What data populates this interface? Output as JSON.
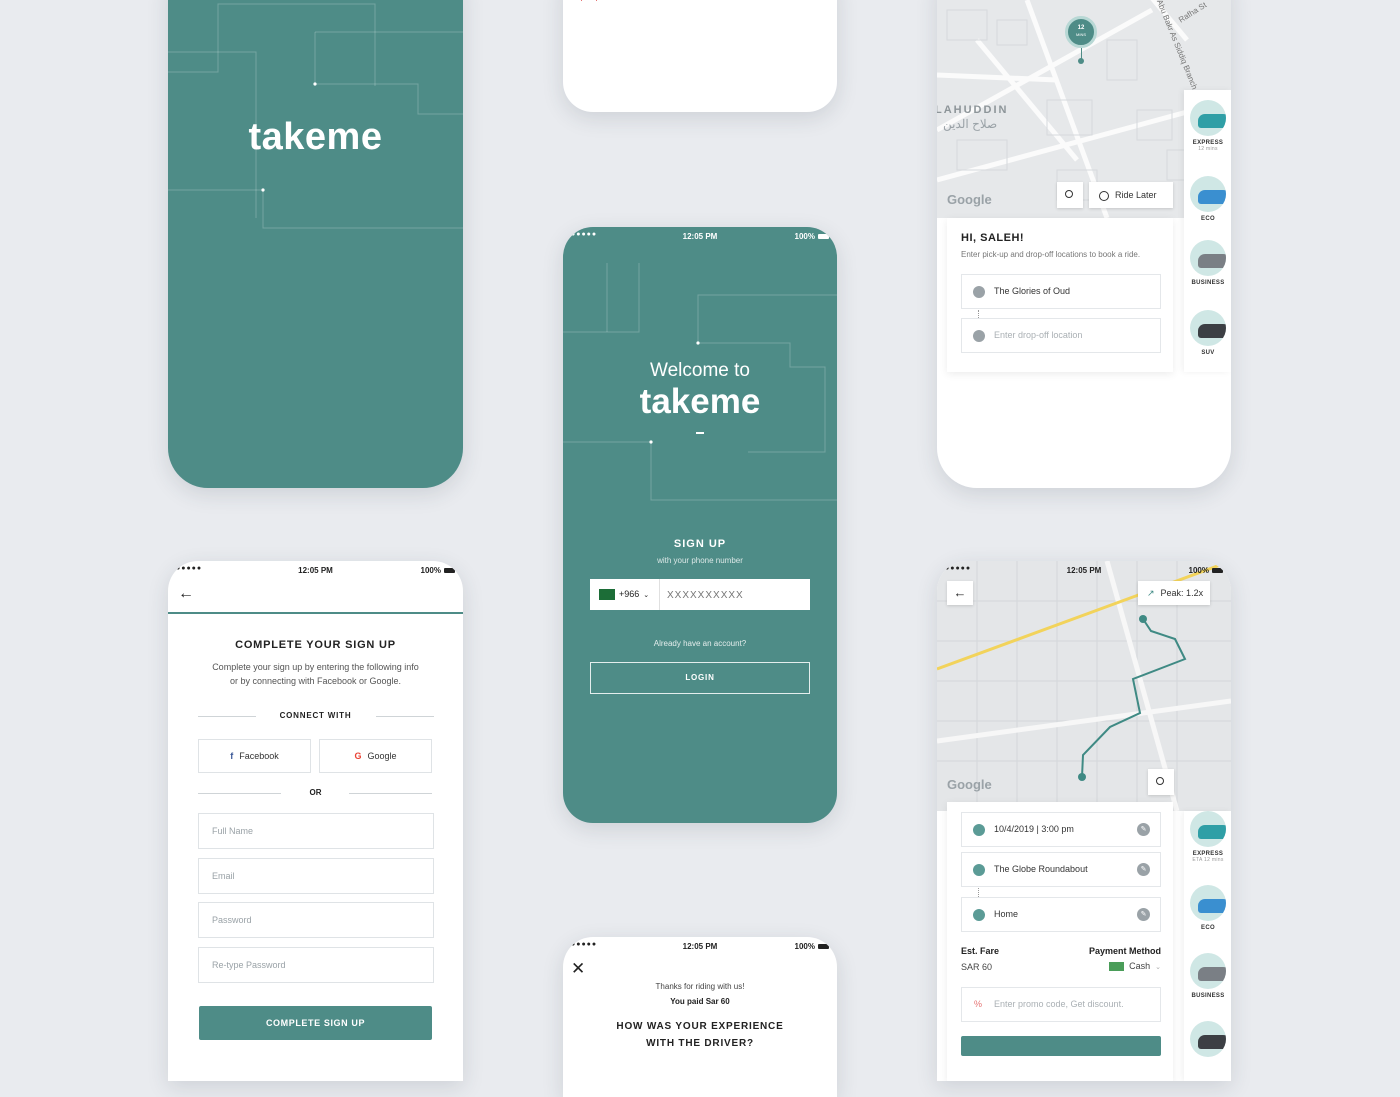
{
  "colors": {
    "teal": "#4e8c87",
    "background": "#e9ebef",
    "route": "#3f8a84",
    "map_road_yellow": "#f2d35b"
  },
  "status_bar": {
    "signal": "●●●●●",
    "time": "12:05 PM",
    "battery": "100%"
  },
  "splash": {
    "brand": "takeme"
  },
  "welcome": {
    "title_line1": "Welcome to",
    "brand": "takeme",
    "signup_title": "SIGN UP",
    "signup_sub": "with your phone number",
    "country_code": "+966",
    "phone_placeholder": "XXXXXXXXXX",
    "already": "Already have an account?",
    "login": "LOGIN"
  },
  "home_map": {
    "eta_number": "12",
    "eta_unit": "MINS",
    "street_1": "Rafha St",
    "street_2": "Abu Bakr As Siddiq Branch",
    "district_en": "LAHUDDIN",
    "district_ar": "صلاح الدين",
    "google": "Google",
    "ride_later": "Ride Later",
    "greeting": "HI, SALEH!",
    "instructions": "Enter pick-up and drop-off locations to book a ride.",
    "pickup": "The Glories of Oud",
    "dropoff_placeholder": "Enter drop-off location",
    "vehicles": [
      {
        "name": "EXPRESS",
        "sub": "12 mins",
        "icon": "car-express-icon",
        "color": "#2f9fa6"
      },
      {
        "name": "ECO",
        "sub": "",
        "icon": "car-eco-icon",
        "color": "#3a8fd0"
      },
      {
        "name": "BUSINESS",
        "sub": "",
        "icon": "car-business-icon",
        "color": "#7a7f85"
      },
      {
        "name": "SUV",
        "sub": "",
        "icon": "car-suv-icon",
        "color": "#3c3f44"
      }
    ]
  },
  "complete_signup": {
    "title": "COMPLETE YOUR SIGN UP",
    "desc_line1": "Complete your sign up by entering the following info",
    "desc_line2": "or by connecting with Facebook or Google.",
    "connect_with": "CONNECT WITH",
    "facebook": "Facebook",
    "google": "Google",
    "or": "OR",
    "full_name": "Full Name",
    "email": "Email",
    "password": "Password",
    "retype_password": "Re-type Password",
    "submit": "COMPLETE SIGN UP"
  },
  "rating": {
    "thanks": "Thanks for riding with us!",
    "paid": "You paid Sar 60",
    "question_line1": "HOW WAS YOUR EXPERIENCE",
    "question_line2": "WITH THE DRIVER?"
  },
  "booking": {
    "peak": "Peak: 1.2x",
    "google": "Google",
    "datetime": "10/4/2019  |  3:00 pm",
    "pickup": "The Globe Roundabout",
    "dropoff": "Home",
    "fare_label": "Est. Fare",
    "fare_value": "SAR 60",
    "payment_label": "Payment Method",
    "payment_value": "Cash",
    "promo_placeholder": "Enter promo code, Get discount.",
    "vehicles": [
      {
        "name": "EXPRESS",
        "sub": "ETA 12 mins",
        "icon": "car-express-icon",
        "color": "#2f9fa6"
      },
      {
        "name": "ECO",
        "sub": "",
        "icon": "car-eco-icon",
        "color": "#3a8fd0"
      },
      {
        "name": "BUSINESS",
        "sub": "",
        "icon": "car-business-icon",
        "color": "#7a7f85"
      },
      {
        "name": "",
        "sub": "",
        "icon": "car-suv-icon",
        "color": "#3c3f44"
      }
    ]
  }
}
